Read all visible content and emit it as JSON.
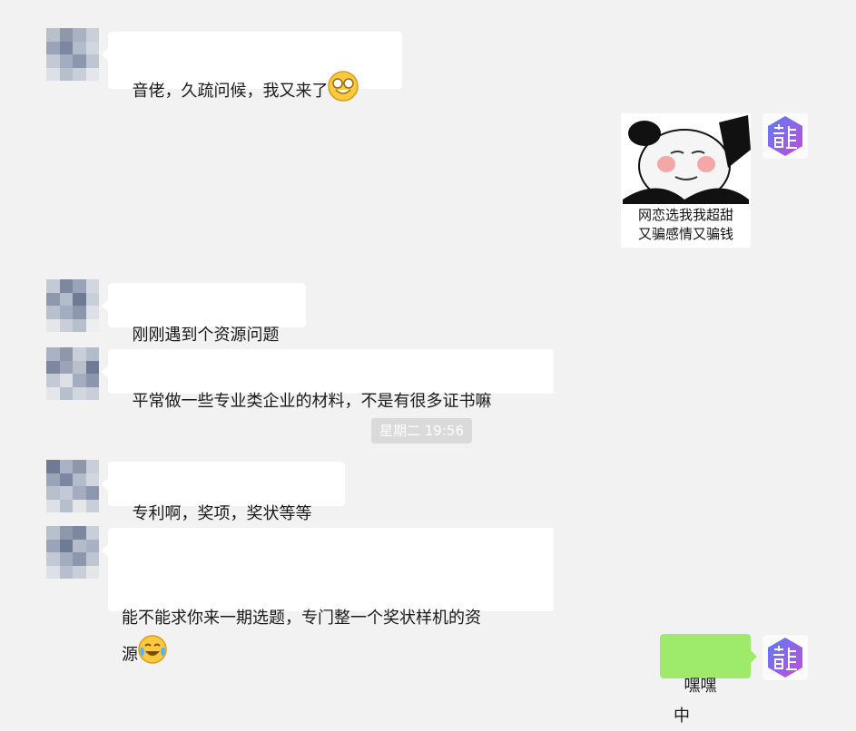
{
  "messages": [
    {
      "sender": "other",
      "text": "音佬，久疏问候，我又来了",
      "emoji": "grinning-glasses-emoji"
    },
    {
      "sender": "self",
      "type": "sticker",
      "caption_line1": "网恋选我我超甜",
      "caption_line2": "又骗感情又骗钱"
    },
    {
      "sender": "other",
      "text": "刚刚遇到个资源问题"
    },
    {
      "sender": "other",
      "text": "平常做一些专业类企业的材料，不是有很多证书嘛"
    },
    {
      "sender": "other",
      "text": "专利啊，奖项，奖状等等"
    },
    {
      "sender": "other",
      "text_line1": "能不能求你来一期选题，专门整一个奖状样机的资",
      "text_line2": "源",
      "emoji": "crying-laughing-emoji"
    },
    {
      "sender": "self",
      "text": "嘿嘿 中"
    }
  ],
  "timestamp": "星期二 19:56",
  "colors": {
    "background": "#f2f2f2",
    "other_bubble": "#ffffff",
    "self_bubble": "#9eea6a",
    "timestamp_bg": "#dadada",
    "logo_gradient_start": "#5b7cf7",
    "logo_gradient_end": "#c04ed8"
  },
  "icons": {
    "self_avatar": "hexagon-logo-icon",
    "other_avatar": "pixelated-avatar"
  }
}
